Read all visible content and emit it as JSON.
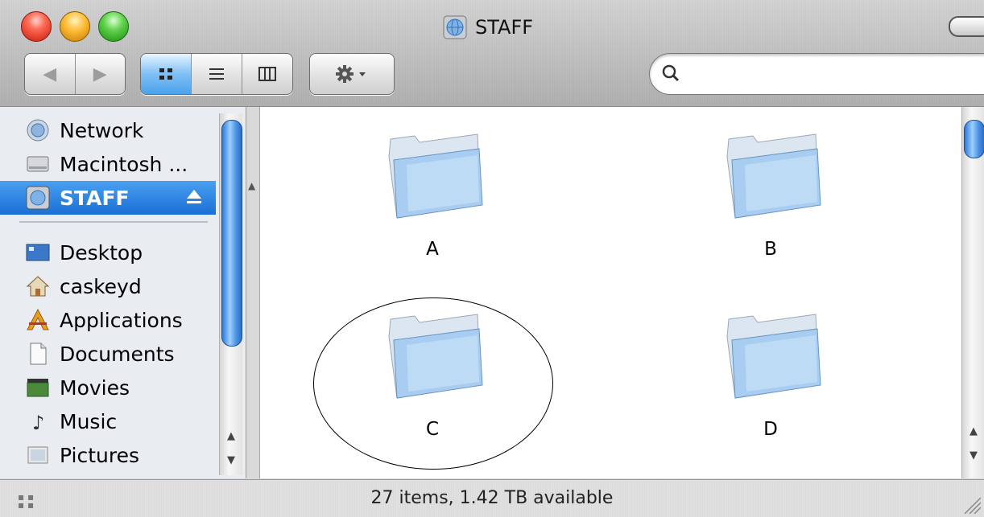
{
  "window": {
    "title": "STAFF"
  },
  "toolbar": {
    "back_label": "◀",
    "forward_label": "▶",
    "search": {
      "value": "",
      "placeholder": ""
    }
  },
  "sidebar": {
    "devices": [
      {
        "label": "Network",
        "icon": "network-globe-icon"
      },
      {
        "label": "Macintosh ...",
        "icon": "hard-drive-icon"
      },
      {
        "label": "STAFF",
        "icon": "network-disk-icon",
        "selected": true,
        "ejectable": true
      }
    ],
    "places": [
      {
        "label": "Desktop",
        "icon": "desktop-icon"
      },
      {
        "label": "caskeyd",
        "icon": "home-icon"
      },
      {
        "label": "Applications",
        "icon": "applications-icon"
      },
      {
        "label": "Documents",
        "icon": "documents-icon"
      },
      {
        "label": "Movies",
        "icon": "movies-icon"
      },
      {
        "label": "Music",
        "icon": "music-icon"
      },
      {
        "label": "Pictures",
        "icon": "pictures-icon"
      }
    ]
  },
  "content": {
    "folders": [
      {
        "label": "A"
      },
      {
        "label": "B"
      },
      {
        "label": "C",
        "annotated": true
      },
      {
        "label": "D"
      }
    ]
  },
  "status": {
    "text": "27 items, 1.42 TB available"
  },
  "colors": {
    "selection": "#1a6fd6",
    "folder": "#9cc9f2"
  }
}
